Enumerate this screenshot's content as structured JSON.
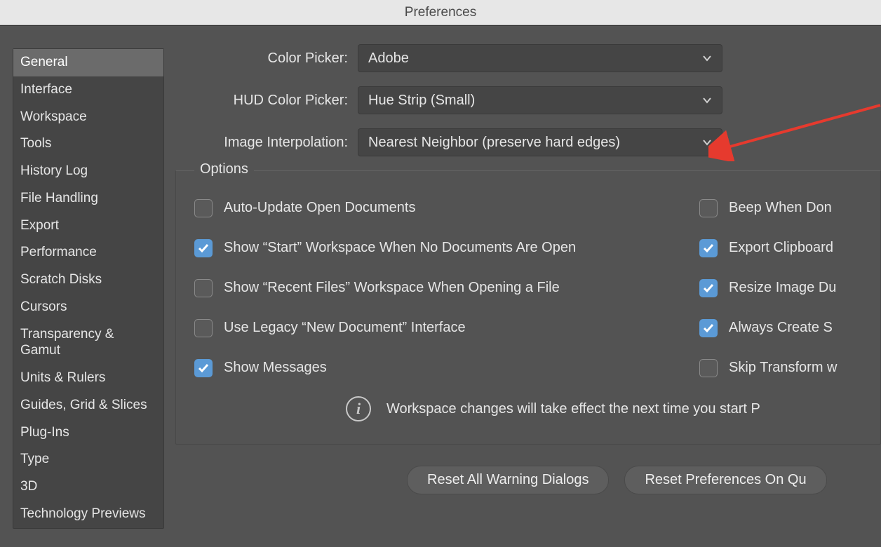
{
  "window": {
    "title": "Preferences"
  },
  "sidebar": {
    "items": [
      {
        "label": "General",
        "selected": true
      },
      {
        "label": "Interface"
      },
      {
        "label": "Workspace"
      },
      {
        "label": "Tools"
      },
      {
        "label": "History Log"
      },
      {
        "label": "File Handling"
      },
      {
        "label": "Export"
      },
      {
        "label": "Performance"
      },
      {
        "label": "Scratch Disks"
      },
      {
        "label": "Cursors"
      },
      {
        "label": "Transparency & Gamut"
      },
      {
        "label": "Units & Rulers"
      },
      {
        "label": "Guides, Grid & Slices"
      },
      {
        "label": "Plug-Ins"
      },
      {
        "label": "Type"
      },
      {
        "label": "3D"
      },
      {
        "label": "Technology Previews"
      }
    ]
  },
  "form": {
    "color_picker": {
      "label": "Color Picker:",
      "value": "Adobe"
    },
    "hud_color_picker": {
      "label": "HUD Color Picker:",
      "value": "Hue Strip (Small)"
    },
    "image_interpolation": {
      "label": "Image Interpolation:",
      "value": "Nearest Neighbor (preserve hard edges)"
    }
  },
  "options": {
    "legend": "Options",
    "left": [
      {
        "label": "Auto-Update Open Documents",
        "checked": false
      },
      {
        "label": "Show “Start” Workspace When No Documents Are Open",
        "checked": true
      },
      {
        "label": "Show “Recent Files” Workspace When Opening a File",
        "checked": false
      },
      {
        "label": "Use Legacy “New Document” Interface",
        "checked": false
      },
      {
        "label": "Show Messages",
        "checked": true
      }
    ],
    "right": [
      {
        "label": "Beep When Don",
        "checked": false
      },
      {
        "label": "Export Clipboard",
        "checked": true
      },
      {
        "label": "Resize Image Du",
        "checked": true
      },
      {
        "label": "Always Create S",
        "checked": true
      },
      {
        "label": "Skip Transform w",
        "checked": false
      }
    ],
    "info": "Workspace changes will take effect the next time you start P"
  },
  "buttons": {
    "reset_warnings": "Reset All Warning Dialogs",
    "reset_prefs": "Reset Preferences On Qu"
  }
}
